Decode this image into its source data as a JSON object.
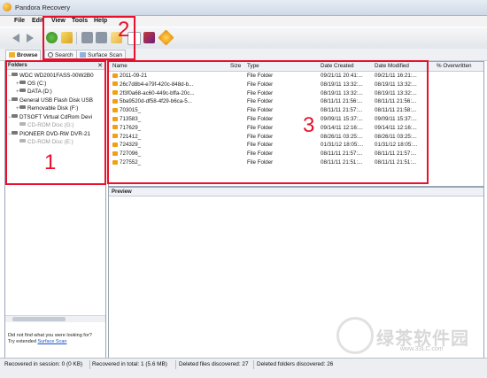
{
  "window": {
    "title": "Pandora Recovery"
  },
  "menu": [
    "File",
    "Edit",
    "View",
    "Tools",
    "Help"
  ],
  "tabs": {
    "browse": "Browse",
    "search": "Search",
    "surface_scan": "Surface Scan"
  },
  "folders_panel": {
    "header": "Folders",
    "close": "✕",
    "tree": [
      {
        "label": "WDC WD2001FASS-00W2B0",
        "level": 0
      },
      {
        "label": "OS (C:)",
        "level": 1
      },
      {
        "label": "DATA (D:)",
        "level": 1
      },
      {
        "label": "General USB Flash Disk USB",
        "level": 0
      },
      {
        "label": "Removable Disk (F:)",
        "level": 1
      },
      {
        "label": "DTSOFT Virtual CdRom Devi",
        "level": 0
      },
      {
        "label": "CD-ROM Disc (G:)",
        "level": 1
      },
      {
        "label": "PIONEER DVD-RW  DVR-21",
        "level": 0
      },
      {
        "label": "CD-ROM Disc (E:)",
        "level": 1
      }
    ],
    "not_found_line1": "Did not find what you were looking for?",
    "not_found_line2": "Try extended",
    "surface_scan_link": "Surface Scan"
  },
  "file_list": {
    "columns": [
      "Name",
      "Size",
      "Type",
      "Date Created",
      "Date Modified",
      "% Overwritten"
    ],
    "rows": [
      {
        "name": "2011-09-21",
        "type": "File Folder",
        "created": "09/21/11 20:41:...",
        "modified": "09/21/11 16:21:..."
      },
      {
        "name": "26c7d8b4-e79f-420c-848d-b...",
        "type": "File Folder",
        "created": "08/19/11 13:32:...",
        "modified": "08/19/11 13:32:..."
      },
      {
        "name": "2f3f0a68-ac60-449c-bffa-20c...",
        "type": "File Folder",
        "created": "08/19/11 13:32:...",
        "modified": "08/19/11 13:32:..."
      },
      {
        "name": "5ba9520d-df58-4f29-b6ca-5...",
        "type": "File Folder",
        "created": "08/11/11 21:56:...",
        "modified": "08/11/11 21:56:..."
      },
      {
        "name": "703015_",
        "type": "File Folder",
        "created": "08/11/11 21:57:...",
        "modified": "08/11/11 21:58:..."
      },
      {
        "name": "713583_",
        "type": "File Folder",
        "created": "09/09/11 15:37:...",
        "modified": "09/09/11 15:37:..."
      },
      {
        "name": "717629_",
        "type": "File Folder",
        "created": "09/14/11 12:16:...",
        "modified": "09/14/11 12:16:..."
      },
      {
        "name": "721412_",
        "type": "File Folder",
        "created": "08/26/11 03:25:...",
        "modified": "08/26/11 03:25:..."
      },
      {
        "name": "724329_",
        "type": "File Folder",
        "created": "01/31/12 18:05:...",
        "modified": "01/31/12 18:05:..."
      },
      {
        "name": "727096_",
        "type": "File Folder",
        "created": "08/11/11 21:57:...",
        "modified": "08/11/11 21:57:..."
      },
      {
        "name": "727552_",
        "type": "File Folder",
        "created": "08/11/11 21:51:...",
        "modified": "08/11/11 21:51:..."
      }
    ]
  },
  "preview": {
    "header": "Preview"
  },
  "status": {
    "session": "Recovered in session: 0 (0 KB)",
    "total": "Recovered in total: 1 (5.6 MB)",
    "deleted_files": "Deleted files discovered: 27",
    "deleted_folders": "Deleted folders discovered: 26"
  },
  "annotations": {
    "box1": "1",
    "box2": "2",
    "box3": "3",
    "color": "#e8102c"
  },
  "watermark": {
    "text": "绿茶软件园",
    "url": "www.33LC.com"
  }
}
